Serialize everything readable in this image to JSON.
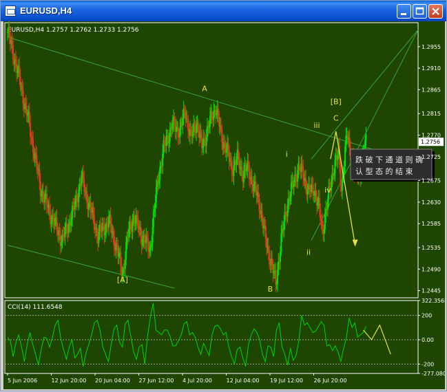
{
  "window": {
    "title": "EURUSD,H4",
    "buttons": [
      "minimize",
      "maximize",
      "close"
    ]
  },
  "colors": {
    "bull": "#00e000",
    "bear": "#e23a1e",
    "channel": "#3aa53a",
    "wave_label": "#e6e14a",
    "annotation_text": "#e8e8e8",
    "cci_line": "#00d800",
    "forecast": "#e6e14a",
    "price_bg": "#1e4600"
  },
  "chart_data": [
    {
      "type": "candlestick",
      "symbol": "EURUSD",
      "timeframe": "H4",
      "info_label": "EURUSD,H4  1.2757 1.2762 1.2733 1.2756",
      "ohlc_current": {
        "open": 1.2757,
        "high": 1.2762,
        "low": 1.2733,
        "close": 1.2756
      },
      "current_price_label": "1.2756",
      "ylim": [
        1.243,
        1.3005
      ],
      "y_ticks": [
        "1.2955",
        "1.2910",
        "1.2865",
        "1.2815",
        "1.2770",
        "1.2725",
        "1.2675",
        "1.2630",
        "1.2585",
        "1.2535",
        "1.2490",
        "1.2445"
      ],
      "x_ticks": [
        "5 Jun 2006",
        "12 Jun 20:00",
        "20 Jun 04:00",
        "27 Jun 12:00",
        "4 Jul 20:00",
        "12 Jul 04:00",
        "19 Jul 12:00",
        "26 Jul 20:00"
      ],
      "price_path": [
        [
          0,
          1.2985
        ],
        [
          3,
          1.292
        ],
        [
          8,
          1.279
        ],
        [
          12,
          1.266
        ],
        [
          16,
          1.26
        ],
        [
          20,
          1.255
        ],
        [
          24,
          1.261
        ],
        [
          27,
          1.268
        ],
        [
          30,
          1.262
        ],
        [
          33,
          1.256
        ],
        [
          37,
          1.259
        ],
        [
          40,
          1.253
        ],
        [
          42,
          1.248
        ],
        [
          44,
          1.256
        ],
        [
          46,
          1.26
        ],
        [
          49,
          1.256
        ],
        [
          52,
          1.253
        ],
        [
          55,
          1.268
        ],
        [
          57,
          1.274
        ],
        [
          60,
          1.279
        ],
        [
          63,
          1.278
        ],
        [
          65,
          1.282
        ],
        [
          67,
          1.2762
        ],
        [
          69,
          1.28
        ],
        [
          71,
          1.2745
        ],
        [
          73,
          1.278
        ],
        [
          76,
          1.283
        ],
        [
          78,
          1.277
        ],
        [
          80,
          1.274
        ],
        [
          82,
          1.27
        ],
        [
          84,
          1.272
        ],
        [
          86,
          1.269
        ],
        [
          88,
          1.27
        ],
        [
          90,
          1.266
        ],
        [
          92,
          1.263
        ],
        [
          94,
          1.256
        ],
        [
          96,
          1.251
        ],
        [
          98,
          1.246
        ],
        [
          100,
          1.255
        ],
        [
          102,
          1.262
        ],
        [
          104,
          1.266
        ],
        [
          106,
          1.27
        ],
        [
          108,
          1.269
        ],
        [
          110,
          1.265
        ],
        [
          112,
          1.266
        ],
        [
          114,
          1.261
        ],
        [
          115,
          1.257
        ],
        [
          117,
          1.263
        ],
        [
          119,
          1.27
        ],
        [
          121,
          1.273
        ],
        [
          122,
          1.266
        ],
        [
          124,
          1.277
        ],
        [
          126,
          1.272
        ],
        [
          127,
          1.268
        ],
        [
          129,
          1.27
        ],
        [
          131,
          1.2756
        ]
      ],
      "channel_lines": [
        {
          "from": [
            0,
            1.2975
          ],
          "to": [
            146,
            1.2718
          ]
        },
        {
          "from": [
            0,
            1.254
          ],
          "to": [
            61,
            1.245
          ]
        },
        {
          "from": [
            111,
            1.272
          ],
          "to": [
            150,
            1.299
          ]
        },
        {
          "from": [
            111,
            1.255
          ],
          "to": [
            150,
            1.299
          ]
        }
      ],
      "wave_labels": [
        {
          "text": "A",
          "x": 72,
          "price": 1.2862
        },
        {
          "text": "[A]",
          "x": 42,
          "price": 1.2462
        },
        {
          "text": "B",
          "x": 96,
          "price": 1.2443
        },
        {
          "text": "i",
          "x": 102,
          "price": 1.2725
        },
        {
          "text": "ii",
          "x": 110,
          "price": 1.252
        },
        {
          "text": "iii",
          "x": 113,
          "price": 1.2785
        },
        {
          "text": "iv",
          "x": 117,
          "price": 1.265
        },
        {
          "text": "C",
          "x": 120,
          "price": 1.28
        },
        {
          "text": "[B]",
          "x": 120,
          "price": 1.2835
        }
      ],
      "forecast_path": [
        [
          118,
          1.272
        ],
        [
          120,
          1.2778
        ],
        [
          127,
          1.254
        ]
      ],
      "annotation": {
        "line1": "跌 破 下 通 道 则 确",
        "line2": "认 型 态 的 结 束"
      }
    },
    {
      "type": "line",
      "indicator": "CCI(14)",
      "value_label": "111.6548",
      "legend": "CCI(14) 111.6548",
      "ylim": [
        -277.08,
        322.3568
      ],
      "y_ticks": [
        "322.3568",
        "200",
        "0.00",
        "-200",
        "-277.080"
      ],
      "levels": [
        200,
        0,
        -200
      ],
      "series": [
        {
          "name": "CCI(14)",
          "values": [
            20,
            -10,
            -140,
            -20,
            40,
            -60,
            -180,
            -40,
            60,
            -40,
            -120,
            -210,
            -80,
            20,
            10,
            -60,
            20,
            120,
            160,
            10,
            -80,
            -160,
            -60,
            0,
            -150,
            -120,
            -70,
            -220,
            -110,
            -40,
            40,
            140,
            160,
            80,
            -60,
            -120,
            -180,
            -40,
            90,
            120,
            -20,
            -60,
            130,
            160,
            30,
            -100,
            -160,
            -60,
            -40,
            -200,
            30,
            190,
            300,
            80,
            60,
            40,
            80,
            80,
            30,
            -50,
            -50,
            -10,
            40,
            130,
            150,
            40,
            60,
            20,
            -60,
            -120,
            -30,
            -80,
            -130,
            40,
            110,
            120,
            90,
            40,
            60,
            -60,
            -140,
            -200,
            -80,
            -60,
            -150,
            -220,
            -40,
            40,
            90,
            60,
            0,
            -120,
            -180,
            -50,
            -60,
            -140,
            80,
            140,
            -60,
            -120,
            -210,
            -70,
            -170,
            -130,
            -10,
            200,
            120,
            140,
            100,
            60,
            70,
            110,
            150,
            120,
            -50,
            -40,
            -90,
            -50,
            -100,
            -180,
            -70,
            20,
            180,
            100,
            140,
            20,
            40,
            60,
            110
          ]
        }
      ],
      "forecast_path": [
        [
          130,
          80
        ],
        [
          133,
          0
        ],
        [
          136,
          120
        ],
        [
          140,
          -120
        ]
      ]
    }
  ]
}
